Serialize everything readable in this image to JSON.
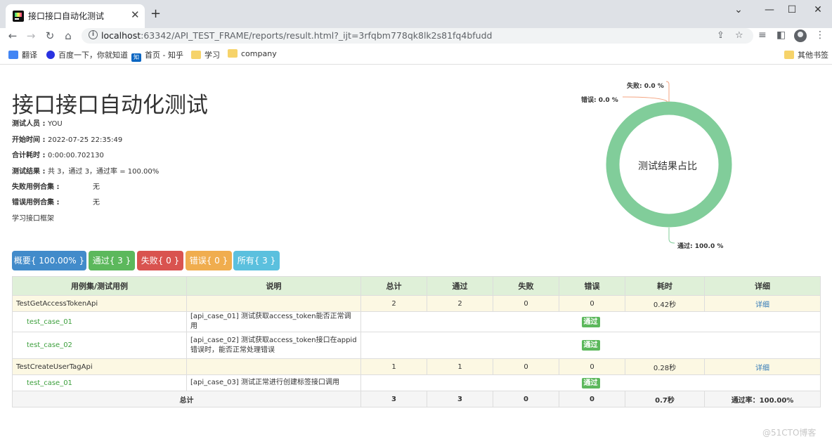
{
  "browser": {
    "tab_title": "接口接口自动化测试",
    "url_host": "localhost",
    "url_path": ":63342/API_TEST_FRAME/reports/result.html?_ijt=3rfqbm778qk8lk2s81fq4bfudd",
    "bookmarks": [
      "翻译",
      "百度一下，你就知道",
      "首页 - 知乎",
      "学习",
      "company"
    ],
    "other_bookmarks": "其他书签"
  },
  "report": {
    "title": "接口接口自动化测试",
    "tester_label": "测试人员 : ",
    "tester_value": "YOU",
    "start_label": "开始时间 : ",
    "start_value": "2022-07-25 22:35:49",
    "duration_label": "合计耗时 : ",
    "duration_value": "0:00:00.702130",
    "result_label": "测试结果 : ",
    "result_value": "共 3，通过 3，通过率 = 100.00%",
    "failed_set_label": "失败用例合集 :",
    "failed_set_value": "无",
    "error_set_label": "错误用例合集 :",
    "error_set_value": "无",
    "description": "学习接口框架"
  },
  "donut": {
    "center_text": "测试结果占比",
    "fail_label": "失败: 0.0 %",
    "error_label": "错误: 0.0 %",
    "pass_label": "通过: 100.0 %",
    "pass_pct": 100.0,
    "fail_pct": 0.0,
    "error_pct": 0.0,
    "pass_color": "#81cd9a"
  },
  "filters": [
    {
      "label": "概要{ 100.00% }",
      "color": "#428bca"
    },
    {
      "label": "通过{ 3 }",
      "color": "#5cb85c"
    },
    {
      "label": "失败{ 0 }",
      "color": "#d9534f"
    },
    {
      "label": "错误{ 0 }",
      "color": "#f0ad4e"
    },
    {
      "label": "所有{ 3 }",
      "color": "#5bc0de"
    }
  ],
  "table": {
    "headers": [
      "用例集/测试用例",
      "说明",
      "总计",
      "通过",
      "失败",
      "错误",
      "耗时",
      "详细"
    ],
    "suite1": {
      "name": "TestGetAccessTokenApi",
      "total": "2",
      "pass": "2",
      "fail": "0",
      "error": "0",
      "time": "0.42秒",
      "detail": "详细"
    },
    "case1": {
      "name": "test_case_01",
      "desc": "[api_case_01] 测试获取access_token能否正常调用",
      "status": "通过"
    },
    "case2": {
      "name": "test_case_02",
      "desc": "[api_case_02] 测试获取access_token接口在appid错误时，能否正常处理错误",
      "status": "通过"
    },
    "suite2": {
      "name": "TestCreateUserTagApi",
      "total": "1",
      "pass": "1",
      "fail": "0",
      "error": "0",
      "time": "0.28秒",
      "detail": "详细"
    },
    "case3": {
      "name": "test_case_01",
      "desc": "[api_case_03] 测试正常进行创建标签接口调用",
      "status": "通过"
    },
    "footer": {
      "label": "总计",
      "total": "3",
      "pass": "3",
      "fail": "0",
      "error": "0",
      "time": "0.7秒",
      "rate": "通过率：100.00%"
    }
  },
  "watermark": "@51CTO博客"
}
